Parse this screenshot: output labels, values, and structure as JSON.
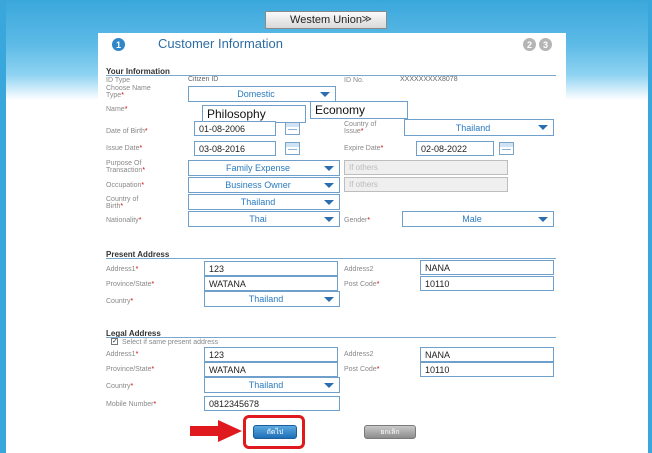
{
  "top_bar": {
    "selected": "Westem Union"
  },
  "header": {
    "step_current": "1",
    "title": "Customer Information",
    "step_2": "2",
    "step_3": "3"
  },
  "your_information": {
    "section_title": "Your Information",
    "id_type_label": "ID Type",
    "id_type_value": "Citizen ID",
    "id_no_label": "ID No.",
    "id_no_value": "XXXXXXXXX8078",
    "name_type_label_1": "Choose Name",
    "name_type_label_2": "Type",
    "name_type_value": "Domestic",
    "name_label": "Name",
    "first_name": "Philosophy",
    "last_name": "Economy",
    "dob_label": "Date of Birth",
    "dob_value": "01-08-2006",
    "country_issue_label_1": "Country of",
    "country_issue_label_2": "Issue",
    "country_issue_value": "Thailand",
    "issue_date_label": "Issue Date",
    "issue_date_value": "03-08-2016",
    "expire_date_label": "Expire Date",
    "expire_date_value": "02-08-2022",
    "purpose_label_1": "Purpose Of",
    "purpose_label_2": "Transaction",
    "purpose_value": "Family Expense",
    "purpose_other_placeholder": "If others",
    "occupation_label": "Occupation",
    "occupation_value": "Business Owner",
    "occupation_other_placeholder": "If others",
    "country_birth_label_1": "Country of",
    "country_birth_label_2": "Birth",
    "country_birth_value": "Thailand",
    "nationality_label": "Nationality",
    "nationality_value": "Thai",
    "gender_label": "Gender",
    "gender_value": "Male"
  },
  "present_address": {
    "section_title": "Present Address",
    "address1_label": "Address1",
    "address1_value": "123",
    "address2_label": "Address2",
    "address2_value": "NANA",
    "province_label": "Province/State",
    "province_value": "WATANA",
    "postcode_label": "Post Code",
    "postcode_value": "10110",
    "country_label": "Country",
    "country_value": "Thailand"
  },
  "legal_address": {
    "section_title": "Legal Address",
    "same_checkbox_label": "Select if same present address",
    "address1_label": "Address1",
    "address1_value": "123",
    "address2_label": "Address2",
    "address2_value": "NANA",
    "province_label": "Province/State",
    "province_value": "WATANA",
    "postcode_label": "Post Code",
    "postcode_value": "10110",
    "country_label": "Country",
    "country_value": "Thailand",
    "mobile_label": "Mobile Number",
    "mobile_value": "0812345678"
  },
  "buttons": {
    "next": "ถัดไป",
    "cancel": "ยกเลิก"
  },
  "required_mark": "*",
  "colors": {
    "accent": "#2e6da4",
    "highlight": "#e0191e",
    "frame": "#3aa7dc"
  }
}
